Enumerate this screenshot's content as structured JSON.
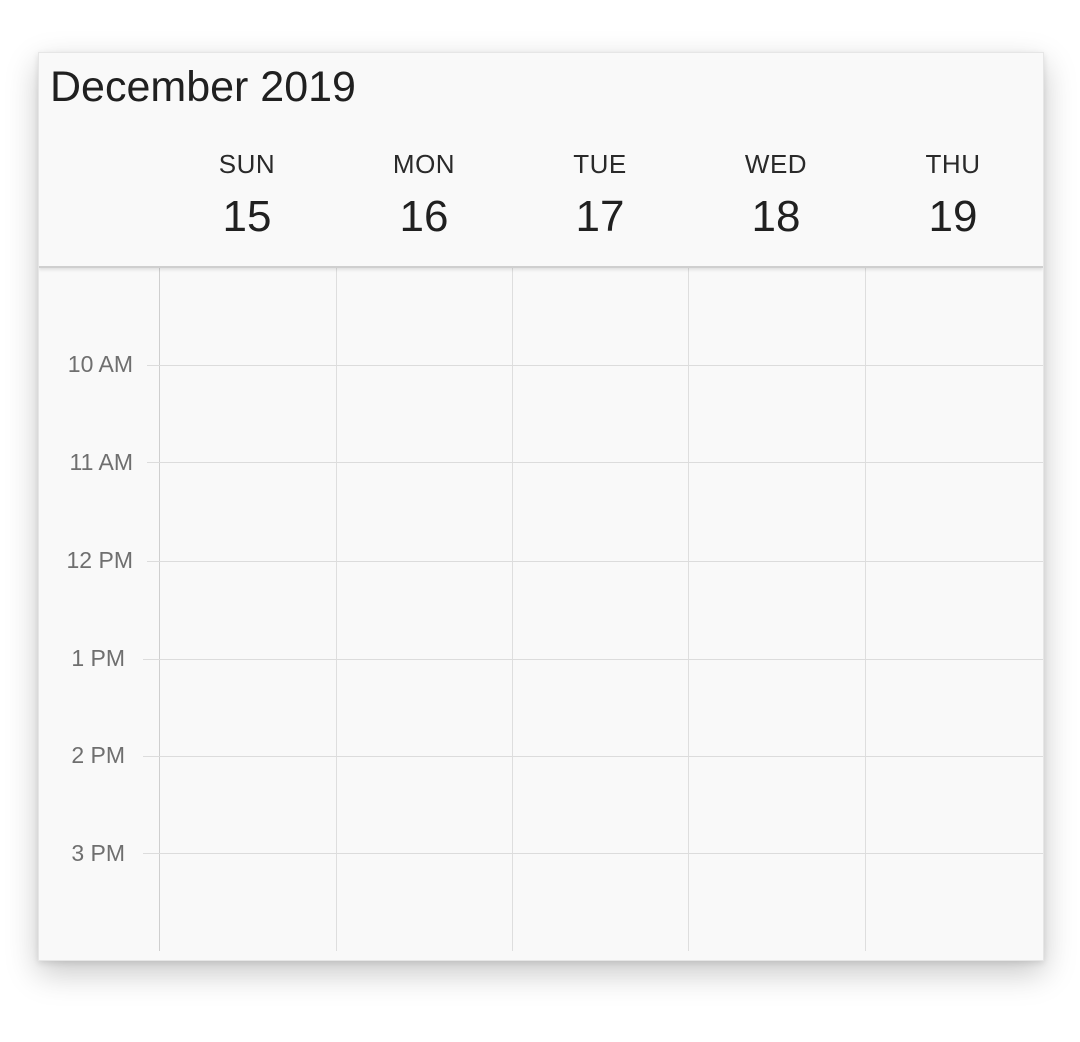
{
  "calendar": {
    "title": "December 2019",
    "days": [
      {
        "dow": "SUN",
        "date": "15"
      },
      {
        "dow": "MON",
        "date": "16"
      },
      {
        "dow": "TUE",
        "date": "17"
      },
      {
        "dow": "WED",
        "date": "18"
      },
      {
        "dow": "THU",
        "date": "19"
      }
    ],
    "times": [
      "10 AM",
      "11 AM",
      "12 PM",
      "1 PM",
      "2 PM",
      "3 PM"
    ]
  }
}
